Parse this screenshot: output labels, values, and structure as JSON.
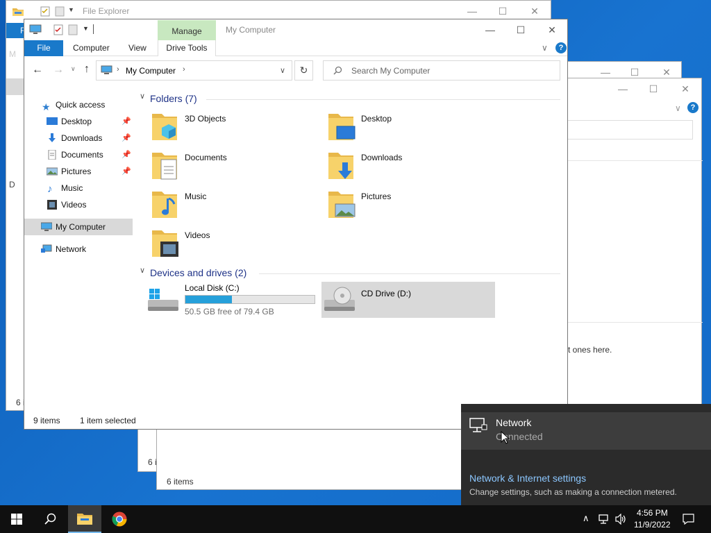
{
  "bg_window1": {
    "title": "File Explorer",
    "file_tab_initial": "F",
    "status_partial": "6 i",
    "left_partial_1": "M",
    "left_partial_2": "D"
  },
  "bg_window2": {
    "status_partial": "6 i"
  },
  "bg_window3": {
    "status": "6 items",
    "partial_text": "t ones here."
  },
  "main": {
    "title": "My Computer",
    "contextual_tab": "Manage",
    "tabs": [
      "File",
      "Computer",
      "View",
      "Drive Tools"
    ],
    "address": "My Computer",
    "search_placeholder": "Search My Computer",
    "nav": {
      "quick_access": "Quick access",
      "items": [
        {
          "label": "Desktop",
          "icon": "desktop-icon",
          "pinned": true
        },
        {
          "label": "Downloads",
          "icon": "downloads-icon",
          "pinned": true
        },
        {
          "label": "Documents",
          "icon": "documents-icon",
          "pinned": true
        },
        {
          "label": "Pictures",
          "icon": "pictures-icon",
          "pinned": true
        },
        {
          "label": "Music",
          "icon": "music-icon",
          "pinned": false
        },
        {
          "label": "Videos",
          "icon": "videos-icon",
          "pinned": false
        }
      ],
      "my_computer": "My Computer",
      "network": "Network"
    },
    "folders_header": "Folders (7)",
    "folders": [
      {
        "name": "3D Objects",
        "icon": "3d-objects-icon"
      },
      {
        "name": "Desktop",
        "icon": "desktop-folder-icon"
      },
      {
        "name": "Documents",
        "icon": "documents-folder-icon"
      },
      {
        "name": "Downloads",
        "icon": "downloads-folder-icon"
      },
      {
        "name": "Music",
        "icon": "music-folder-icon"
      },
      {
        "name": "Pictures",
        "icon": "pictures-folder-icon"
      },
      {
        "name": "Videos",
        "icon": "videos-folder-icon"
      }
    ],
    "drives_header": "Devices and drives (2)",
    "drives": [
      {
        "name": "Local Disk (C:)",
        "free_text": "50.5 GB free of 79.4 GB",
        "used_fraction": 0.36
      },
      {
        "name": "CD Drive (D:)"
      }
    ],
    "status": {
      "count": "9 items",
      "selected": "1 item selected"
    }
  },
  "flyout": {
    "network_name": "Network",
    "network_status": "Connected",
    "settings_link": "Network & Internet settings",
    "settings_desc": "Change settings, such as making a connection metered."
  },
  "taskbar": {
    "time": "4:56 PM",
    "date": "11/9/2022"
  },
  "colors": {
    "accent": "#1979ca",
    "manage_tab": "#c8e8c0",
    "flyout_bg": "#2b2b2b",
    "link": "#8cc7ff",
    "drive_bar": "#26a0da"
  }
}
